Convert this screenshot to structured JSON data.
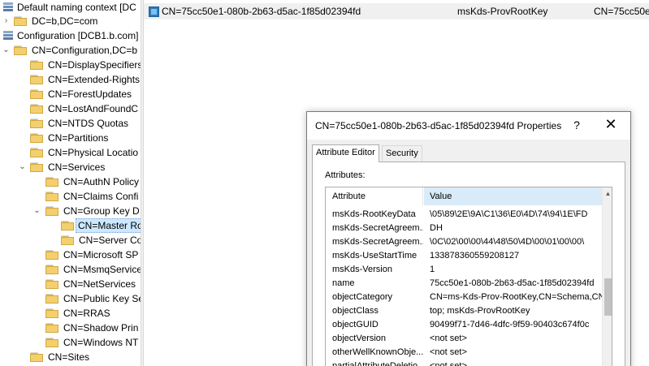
{
  "tree": {
    "root1": "Default naming context [DC",
    "root1_child": "DC=b,DC=com",
    "root2": "Configuration [DCB1.b.com]",
    "config_node": "CN=Configuration,DC=b",
    "items": [
      "CN=DisplaySpecifiers",
      "CN=Extended-Rights",
      "CN=ForestUpdates",
      "CN=LostAndFoundC",
      "CN=NTDS Quotas",
      "CN=Partitions",
      "CN=Physical Locatio",
      "CN=Services"
    ],
    "services_children": [
      "CN=AuthN Policy",
      "CN=Claims Confi",
      "CN=Group Key D"
    ],
    "gkds_children": [
      "CN=Master Ro",
      "CN=Server Co"
    ],
    "services_children2": [
      "CN=Microsoft SP",
      "CN=MsmqService",
      "CN=NetServices",
      "CN=Public Key Se",
      "CN=RRAS",
      "CN=Shadow Prin",
      "CN=Windows NT"
    ],
    "last_item": "CN=Sites"
  },
  "list": {
    "name": "CN=75cc50e1-080b-2b63-d5ac-1f85d02394fd",
    "class": "msKds-ProvRootKey",
    "dn": "CN=75cc50e"
  },
  "dialog": {
    "title": "CN=75cc50e1-080b-2b63-d5ac-1f85d02394fd Properties",
    "help": "?",
    "close": "✕",
    "tab_attribute_editor": "Attribute Editor",
    "tab_security": "Security",
    "attributes_label": "Attributes:",
    "header_attribute": "Attribute",
    "header_value": "Value",
    "rows": [
      {
        "name": "msKds-RootKeyData",
        "value": "\\05\\89\\2E\\9A\\C1\\36\\E0\\4D\\74\\94\\1E\\FD"
      },
      {
        "name": "msKds-SecretAgreem...",
        "value": "DH"
      },
      {
        "name": "msKds-SecretAgreem...",
        "value": "\\0C\\02\\00\\00\\44\\48\\50\\4D\\00\\01\\00\\00\\"
      },
      {
        "name": "msKds-UseStartTime",
        "value": "133878360559208127"
      },
      {
        "name": "msKds-Version",
        "value": "1"
      },
      {
        "name": "name",
        "value": "75cc50e1-080b-2b63-d5ac-1f85d02394fd"
      },
      {
        "name": "objectCategory",
        "value": "CN=ms-Kds-Prov-RootKey,CN=Schema,CN="
      },
      {
        "name": "objectClass",
        "value": "top; msKds-ProvRootKey"
      },
      {
        "name": "objectGUID",
        "value": "90499f71-7d46-4dfc-9f59-90403c674f0c"
      },
      {
        "name": "objectVersion",
        "value": "<not set>"
      },
      {
        "name": "otherWellKnownObje...",
        "value": "<not set>"
      },
      {
        "name": "partialAttributeDeletio...",
        "value": "<not set>"
      }
    ]
  }
}
